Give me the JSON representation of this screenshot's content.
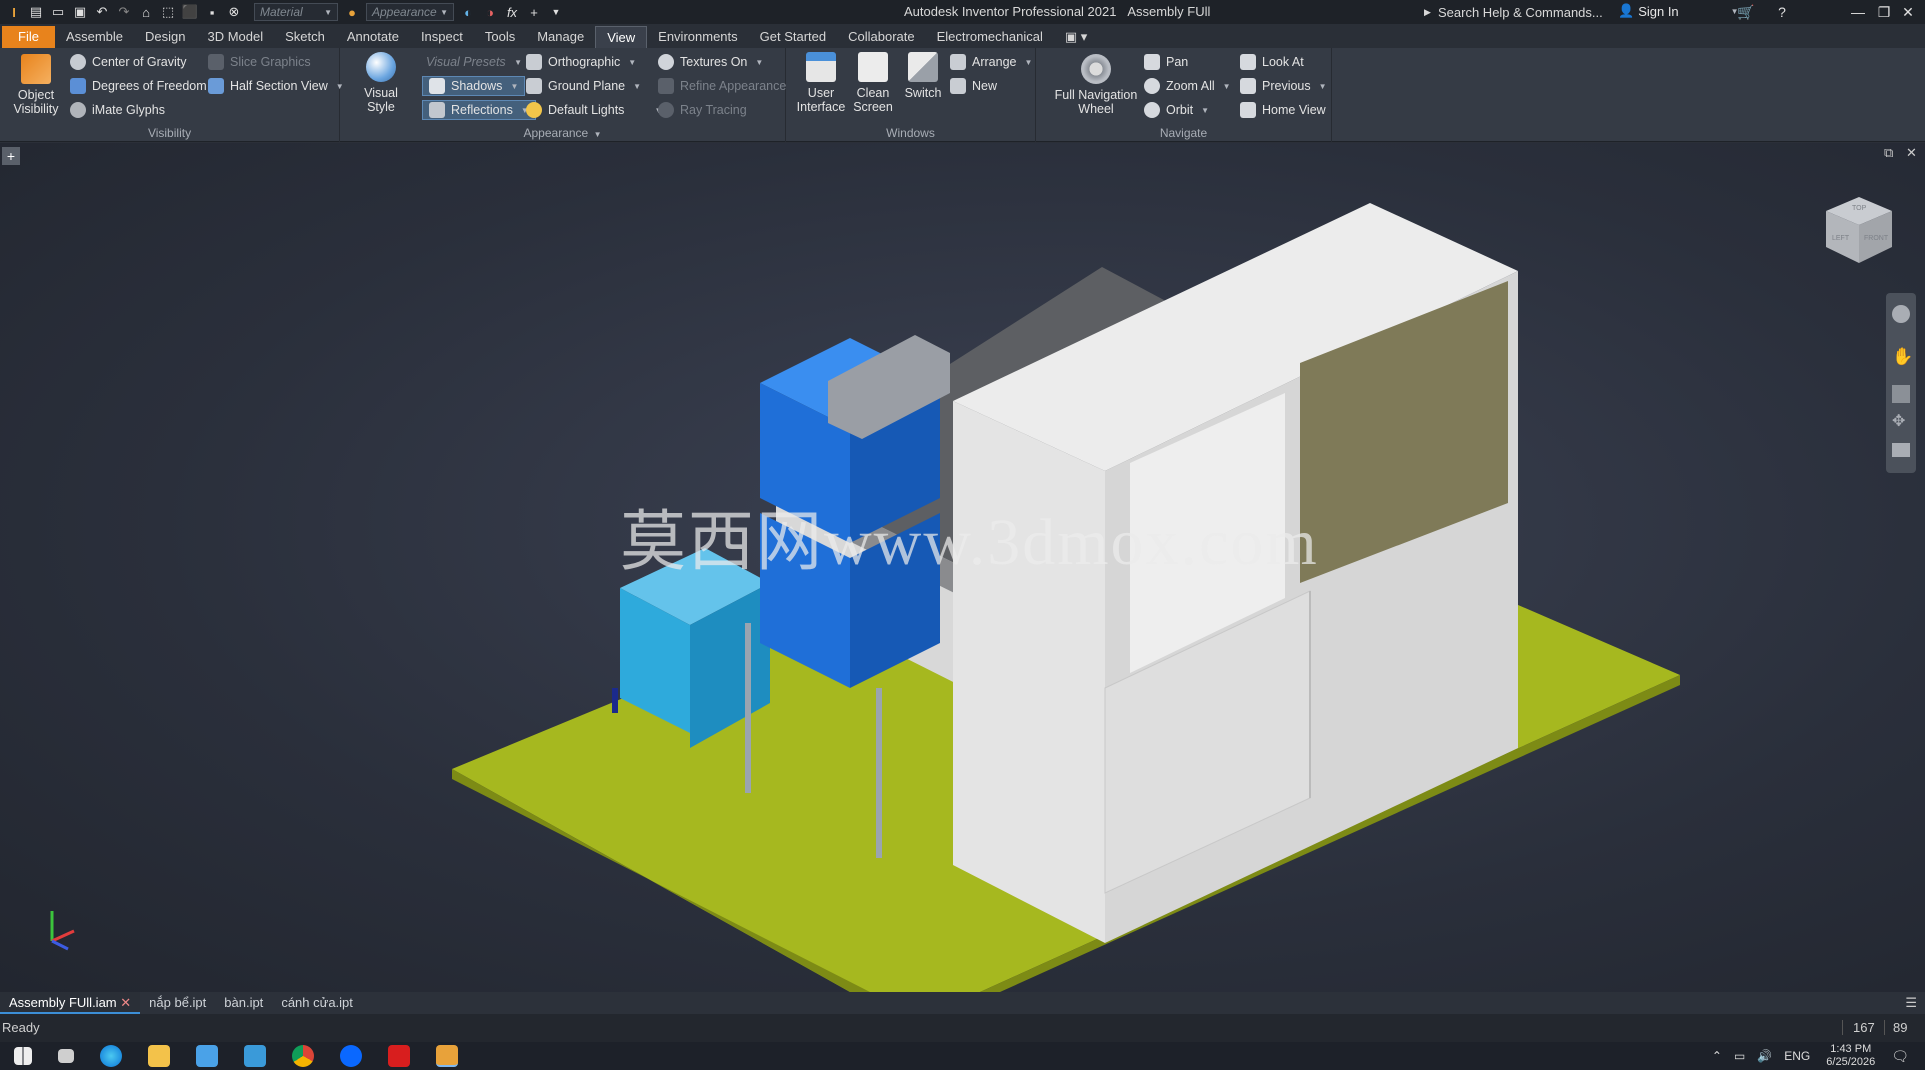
{
  "app": {
    "title": "Autodesk Inventor Professional 2021",
    "document": "Assembly FUll",
    "material_placeholder": "Material",
    "appearance_placeholder": "Appearance",
    "search_label": "Search Help & Commands...",
    "signin_label": "Sign In"
  },
  "ribbon_tabs": [
    "File",
    "Assemble",
    "Design",
    "3D Model",
    "Sketch",
    "Annotate",
    "Inspect",
    "Tools",
    "Manage",
    "View",
    "Environments",
    "Get Started",
    "Collaborate",
    "Electromechanical"
  ],
  "active_tab": "View",
  "visibility": {
    "title": "Visibility",
    "object_visibility": "Object\nVisibility",
    "center_of_gravity": "Center of Gravity",
    "degrees_of_freedom": "Degrees of Freedom",
    "imate_glyphs": "iMate Glyphs",
    "slice_graphics": "Slice Graphics",
    "half_section_view": "Half Section View"
  },
  "appearance": {
    "title": "Appearance",
    "visual_style": "Visual Style",
    "visual_presets": "Visual Presets",
    "shadows": "Shadows",
    "reflections": "Reflections",
    "orthographic": "Orthographic",
    "ground_plane": "Ground Plane",
    "default_lights": "Default Lights",
    "textures_on": "Textures On",
    "refine_appearance": "Refine Appearance",
    "ray_tracing": "Ray Tracing"
  },
  "windows": {
    "title": "Windows",
    "user_interface": "User\nInterface",
    "clean_screen": "Clean\nScreen",
    "switch": "Switch",
    "arrange": "Arrange",
    "new": "New"
  },
  "navigate": {
    "title": "Navigate",
    "full_navigation_wheel": "Full Navigation\nWheel",
    "pan": "Pan",
    "zoom_all": "Zoom All",
    "orbit": "Orbit",
    "look_at": "Look At",
    "previous": "Previous",
    "home_view": "Home View"
  },
  "viewcube": {
    "top": "TOP",
    "left": "LEFT",
    "front": "FRONT"
  },
  "watermark": "莫西网www.3dmox.com",
  "document_tabs": [
    "Assembly FUll.iam",
    "nắp bể.ipt",
    "bàn.ipt",
    "cánh cửa.ipt"
  ],
  "status": {
    "text": "Ready",
    "num1": "167",
    "num2": "89"
  },
  "taskbar": {
    "lang": "ENG",
    "time": "1:43 PM",
    "date": "6/25/2026"
  },
  "colors": {
    "accent": "#e8831c",
    "ground": "#a6b81f",
    "blue_unit": "#1f6fd8",
    "cyan_unit": "#2eaadc",
    "cabinet": "#e4e4e4"
  }
}
